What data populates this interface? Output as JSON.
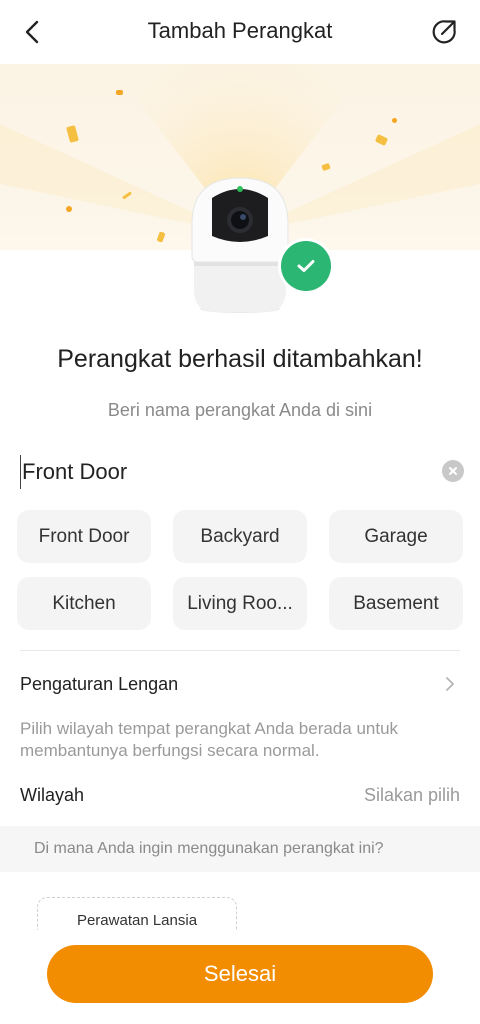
{
  "header": {
    "title": "Tambah Perangkat"
  },
  "status": {
    "message": "Perangkat berhasil ditambahkan!",
    "name_prompt": "Beri nama perangkat Anda di sini"
  },
  "name_input": {
    "value": "Front Door"
  },
  "name_suggestions": [
    {
      "label": "Front Door"
    },
    {
      "label": "Backyard"
    },
    {
      "label": "Garage"
    },
    {
      "label": "Kitchen"
    },
    {
      "label": "Living Roo..."
    },
    {
      "label": "Basement"
    }
  ],
  "arm_settings": {
    "label": "Pengaturan Lengan"
  },
  "region": {
    "description": "Pilih wilayah tempat perangkat Anda berada untuk membantunya berfungsi secara normal.",
    "label": "Wilayah",
    "value": "Silakan pilih"
  },
  "usage": {
    "question": "Di mana Anda ingin menggunakan perangkat ini?",
    "options": [
      {
        "label": "Perawatan Lansia"
      }
    ]
  },
  "actions": {
    "done_label": "Selesai"
  },
  "colors": {
    "accent": "#f28c00",
    "success": "#2bb673",
    "hero_bg": "#fbf3e4"
  }
}
